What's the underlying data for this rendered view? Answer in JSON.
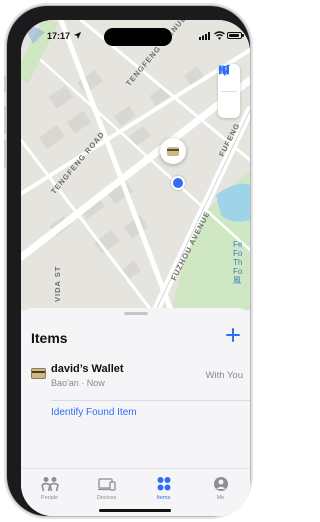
{
  "status_bar": {
    "time": "17:17"
  },
  "map": {
    "street_labels": [
      "TENGFENG AVENUE",
      "TENGFENG ROAD",
      "FUZHOU AVENUE",
      "FUFENG",
      "VIDA ST"
    ],
    "poi_label_lines": [
      "Fe",
      "Fo",
      "Th",
      "Fo",
      "風"
    ],
    "colors": {
      "land": "#e6e4df",
      "road": "#ffffff",
      "park": "#cfe7c3",
      "water": "#9fd3ea",
      "block": "#d9d7d2"
    }
  },
  "sheet": {
    "title": "Items",
    "items": [
      {
        "name": "david’s Wallet",
        "location": "Bao'an · Now",
        "status": "With You",
        "icon": "wallet-icon"
      }
    ],
    "action": "Identify Found Item"
  },
  "tabs": [
    {
      "label": "People",
      "icon": "people-icon",
      "active": false
    },
    {
      "label": "Devices",
      "icon": "devices-icon",
      "active": false
    },
    {
      "label": "Items",
      "icon": "items-icon",
      "active": true
    },
    {
      "label": "Me",
      "icon": "me-icon",
      "active": false
    }
  ],
  "accent_color": "#2f6df6"
}
